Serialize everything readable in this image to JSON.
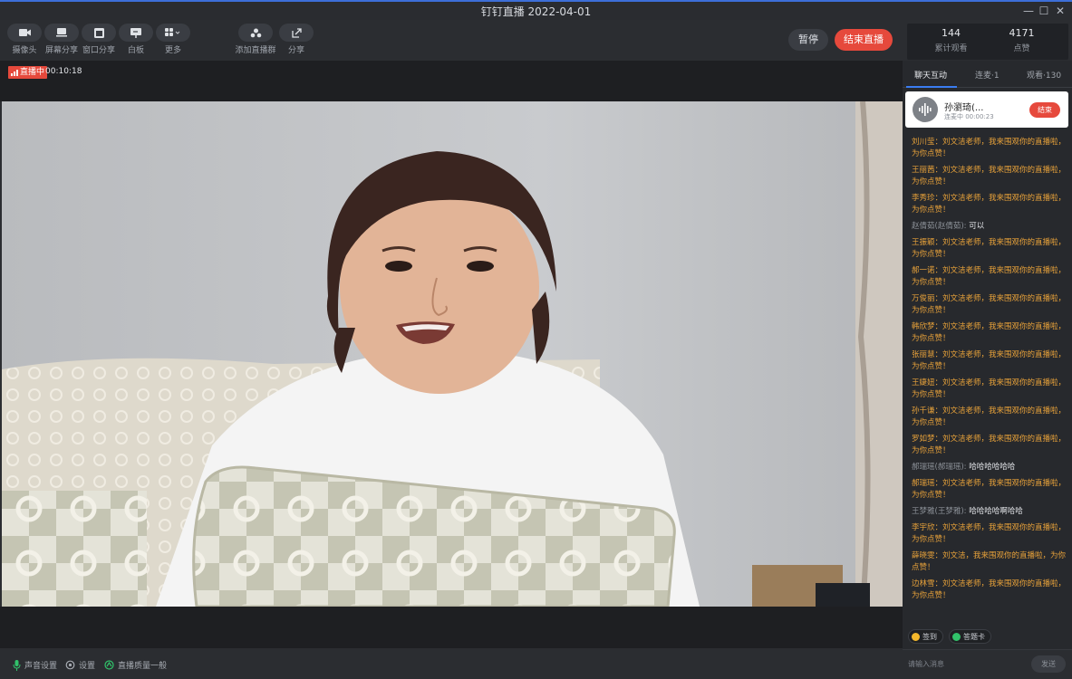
{
  "window": {
    "title": "钉钉直播 2022-04-01",
    "controls": {
      "minimize": "—",
      "maximize": "☐",
      "close": "✕"
    }
  },
  "toolbar": {
    "camera": "摄像头",
    "screen_share": "屏幕分享",
    "window_share": "窗口分享",
    "whiteboard": "白板",
    "more": "更多",
    "add_group": "添加直播群",
    "share": "分享",
    "pause": "暂停",
    "end_live": "结束直播"
  },
  "stats": {
    "viewers_value": "144",
    "viewers_label": "累计观看",
    "likes_value": "4171",
    "likes_label": "点赞"
  },
  "stage": {
    "live_badge": "直播中",
    "elapsed": "00:10:18"
  },
  "tabs": {
    "chat": "聊天互动",
    "co_host": "连麦·1",
    "viewers": "观看·130"
  },
  "mic": {
    "name": "孙瀏琦(...",
    "status": "连麦中 00:00:23",
    "end_label": "结束"
  },
  "chat": [
    {
      "type": "like",
      "text": "刘川莹：刘文洁老师，我来围观你的直播啦，为你点赞！"
    },
    {
      "type": "like",
      "text": "王丽茜：刘文洁老师，我来围观你的直播啦，为你点赞！"
    },
    {
      "type": "like",
      "text": "李秀珍：刘文洁老师，我来围观你的直播啦，为你点赞！"
    },
    {
      "type": "plain",
      "name": "赵倩茹(赵倩茹):",
      "text": " 可以"
    },
    {
      "type": "like",
      "text": "王振颖：刘文洁老师，我来围观你的直播啦，为你点赞！"
    },
    {
      "type": "like",
      "text": "郝一诺：刘文洁老师，我来围观你的直播啦，为你点赞！"
    },
    {
      "type": "like",
      "text": "万俊丽：刘文洁老师，我来围观你的直播啦，为你点赞！"
    },
    {
      "type": "like",
      "text": "韩欣梦：刘文洁老师，我来围观你的直播啦，为你点赞！"
    },
    {
      "type": "like",
      "text": "张丽慧：刘文洁老师，我来围观你的直播啦，为你点赞！"
    },
    {
      "type": "like",
      "text": "王婕妞：刘文洁老师，我来围观你的直播啦，为你点赞！"
    },
    {
      "type": "like",
      "text": "孙千谦：刘文洁老师，我来围观你的直播啦，为你点赞！"
    },
    {
      "type": "like",
      "text": "罗如梦：刘文洁老师，我来围观你的直播啦，为你点赞！"
    },
    {
      "type": "plain",
      "name": "郝瑞瑶(郝瑞瑶):",
      "text": " 哈哈哈哈哈哈"
    },
    {
      "type": "like",
      "text": "郝瑞瑶：刘文洁老师，我来围观你的直播啦，为你点赞！"
    },
    {
      "type": "plain",
      "name": "王梦雅(王梦雅):",
      "text": " 哈哈哈哈啊哈哈"
    },
    {
      "type": "like",
      "text": "李宇欣：刘文洁老师，我来围观你的直播啦，为你点赞！"
    },
    {
      "type": "like",
      "text": "薛晓雯：刘文洁，我来围观你的直播啦，为你点赞！"
    },
    {
      "type": "like",
      "text": "边林雪：刘文洁老师，我来围观你的直播啦，为你点赞！"
    }
  ],
  "chips": {
    "checkin": "签到",
    "answer_card": "答题卡"
  },
  "input": {
    "placeholder": "请输入消息",
    "send": "发送"
  },
  "status": {
    "audio": "声音设置",
    "settings": "设置",
    "quality": "直播质量一般"
  },
  "colors": {
    "accent_red": "#e6493c",
    "accent_blue": "#3a7cf2",
    "like_text": "#e8a23a",
    "panel_bg": "#27292d"
  }
}
